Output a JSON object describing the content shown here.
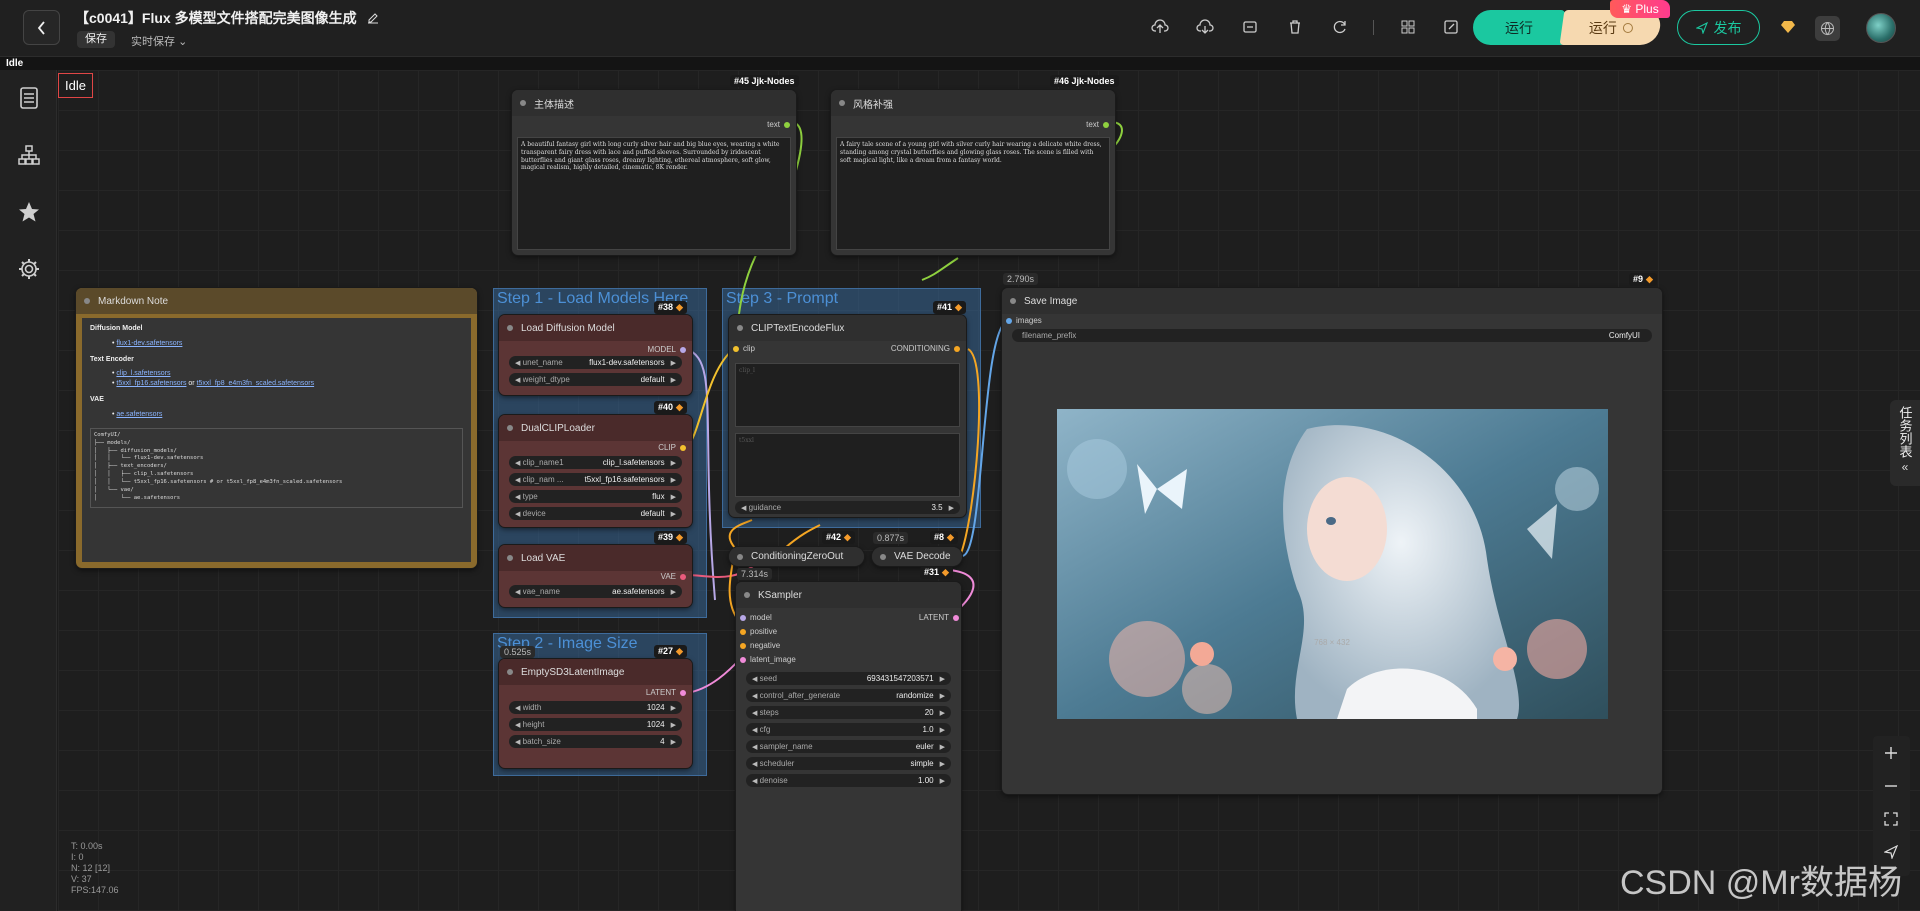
{
  "app": {
    "title": "【c0041】Flux 多模型文件搭配完美图像生成",
    "save_label": "保存",
    "autosave_label": "实时保存",
    "status_top": "Idle",
    "idle_label": "Idle"
  },
  "toolbar": {
    "run_label": "运行",
    "run_plus_label": "运行",
    "plus_badge": "Plus",
    "publish_label": "发布",
    "icons": [
      "upload-icon",
      "download-icon",
      "export-icon",
      "delete-icon",
      "refresh-icon",
      "grid-icon",
      "edit-icon"
    ]
  },
  "sidebar": {
    "items": [
      "node-library-icon",
      "workflow-tree-icon",
      "favorites-star-icon",
      "settings-gear-icon"
    ]
  },
  "groups": {
    "load_models": "Step 1 - Load Models Here",
    "image_size": "Step 2 - Image Size",
    "prompt": "Step 3 - Prompt"
  },
  "nodes": {
    "main_prompt": {
      "title": "主体描述",
      "badge": "#45 Jjk-Nodes",
      "output": "text",
      "text": "A beautiful fantasy girl with long curly silver hair and big blue eyes, wearing a white transparent fairy dress with lace and puffed sleeves. Surrounded by iridescent butterflies and giant glass roses, dreamy lighting, ethereal atmosphere, soft glow, magical realism, highly detailed, cinematic, 8K render."
    },
    "style_prompt": {
      "title": "风格补强",
      "badge": "#46 Jjk-Nodes",
      "output": "text",
      "text": "A fairy tale scene of a young girl with silver curly hair wearing a delicate white dress, standing among crystal butterflies and glowing glass roses. The scene is filled with soft magical light, like a dream from a fantasy world."
    },
    "markdown": {
      "title": "Markdown Note",
      "h1": "Diffusion Model",
      "l1": "flux1-dev.safetensors",
      "h2": "Text Encoder",
      "l2": "clip_l.safetensors",
      "l3a": "t5xxl_fp16.safetensors",
      "l3_or": " or ",
      "l3b": "t5xxl_fp8_e4m3fn_scaled.safetensors",
      "h3": "VAE",
      "l4": "ae.safetensors",
      "tree": "ComfyUI/\n├── models/\n│   ├── diffusion_models/\n│   │   └── flux1-dev.safetensors\n│   ├── text_encoders/\n│   │   ├── clip_l.safetensors\n│   │   └── t5xxl_fp16.safetensors # or t5xxl_fp8_e4m3fn_scaled.safetensors\n│   └── vae/\n│       └── ae.safetensors"
    },
    "load_diffusion": {
      "title": "Load Diffusion Model",
      "badge": "#38",
      "output": "MODEL",
      "w1_label": "unet_name",
      "w1_val": "flux1-dev.safetensors",
      "w2_label": "weight_dtype",
      "w2_val": "default"
    },
    "dual_clip": {
      "title": "DualCLIPLoader",
      "badge": "#40",
      "output": "CLIP",
      "w1_label": "clip_name1",
      "w1_val": "clip_l.safetensors",
      "w2_label": "clip_nam ...",
      "w2_val": "t5xxl_fp16.safetensors",
      "w3_label": "type",
      "w3_val": "flux",
      "w4_label": "device",
      "w4_val": "default"
    },
    "load_vae": {
      "title": "Load VAE",
      "badge": "#39",
      "output": "VAE",
      "w1_label": "vae_name",
      "w1_val": "ae.safetensors"
    },
    "empty_latent": {
      "title": "EmptySD3LatentImage",
      "badge": "#27",
      "timing": "0.525s",
      "output": "LATENT",
      "w1_label": "width",
      "w1_val": "1024",
      "w2_label": "height",
      "w2_val": "1024",
      "w3_label": "batch_size",
      "w3_val": "4"
    },
    "clip_encode": {
      "title": "CLIPTextEncodeFlux",
      "badge": "#41",
      "input": "clip",
      "output": "CONDITIONING",
      "ph1": "clip_l",
      "ph2": "t5xxl",
      "w1_label": "guidance",
      "w1_val": "3.5"
    },
    "cond_zero": {
      "title": "ConditioningZeroOut",
      "badge": "#42",
      "timing": "7.314s"
    },
    "vae_decode": {
      "title": "VAE Decode",
      "badge": "#8",
      "timing": "0.877s"
    },
    "ksampler": {
      "title": "KSampler",
      "badge": "#31",
      "in1": "model",
      "in2": "positive",
      "in3": "negative",
      "in4": "latent_image",
      "output": "LATENT",
      "widgets": [
        {
          "label": "seed",
          "val": "693431547203571"
        },
        {
          "label": "control_after_generate",
          "val": "randomize"
        },
        {
          "label": "steps",
          "val": "20"
        },
        {
          "label": "cfg",
          "val": "1.0"
        },
        {
          "label": "sampler_name",
          "val": "euler"
        },
        {
          "label": "scheduler",
          "val": "simple"
        },
        {
          "label": "denoise",
          "val": "1.00"
        }
      ]
    },
    "save_image": {
      "title": "Save Image",
      "badge": "#9",
      "timing": "2.790s",
      "input": "images",
      "w1_label": "filename_prefix",
      "w1_val": "ComfyUI",
      "image_size": "768 × 432"
    }
  },
  "right_panel": {
    "tasklist_label": "任务列表"
  },
  "stats": {
    "t": "T: 0.00s",
    "i": "I: 0",
    "n": "N: 12 [12]",
    "v": "V: 37",
    "fps": "FPS:147.06"
  },
  "watermark": "CSDN @Mr数据杨",
  "colors": {
    "accent": "#1bc8a0",
    "plus": "#f6d9b0",
    "group": "#365f8f",
    "markdown_frame": "#8a6a2c"
  }
}
